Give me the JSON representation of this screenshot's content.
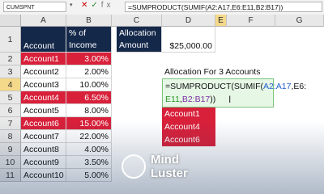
{
  "formula_bar": {
    "name_box": "CUMSPNT",
    "formula": "=SUMPRODUCT(SUMIF(A2:A17,E6:E11,B2:B17))"
  },
  "columns": [
    "A",
    "B",
    "C",
    "D",
    "E",
    "F",
    "G"
  ],
  "rows": [
    "1",
    "2",
    "3",
    "4",
    "5",
    "6",
    "7",
    "8",
    "9",
    "10",
    "11"
  ],
  "headers": {
    "account": "Account",
    "pct_income": "% of Income",
    "allocation_amount": "Allocation Amount",
    "allocation_value": "$25,000.00"
  },
  "accounts": [
    {
      "name": "Account1",
      "pct": "3.00%"
    },
    {
      "name": "Account2",
      "pct": "2.00%"
    },
    {
      "name": "Account3",
      "pct": "10.00%"
    },
    {
      "name": "Account4",
      "pct": "6.50%"
    },
    {
      "name": "Account5",
      "pct": "8.00%"
    },
    {
      "name": "Account6",
      "pct": "15.00%"
    },
    {
      "name": "Account7",
      "pct": "22.00%"
    },
    {
      "name": "Account8",
      "pct": "4.00%"
    },
    {
      "name": "Account9",
      "pct": "3.50%"
    },
    {
      "name": "Account10",
      "pct": "5.00%"
    }
  ],
  "allocation_title": "Allocation For 3 Accounts",
  "editing": {
    "part1": "=SUMPRODUCT(SUMIF(",
    "ref1": "A2:A17",
    "sep1": ",E6:",
    "ref2": "E11",
    "sep2": ",",
    "ref3": "B2:B17",
    "end": "))"
  },
  "selected_accounts": [
    "Account1",
    "Account4",
    "Account6"
  ],
  "logo": {
    "line1": "Mind",
    "line2": "Luster"
  },
  "colors": {
    "header_dark": "#14284a",
    "highlight_red": "#d8203a",
    "edit_green": "#e6f7e6"
  }
}
